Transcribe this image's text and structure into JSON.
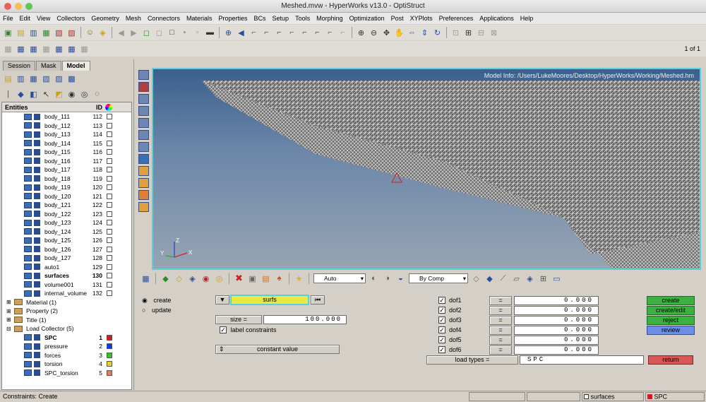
{
  "window": {
    "title": "Meshed.mvw - HyperWorks v13.0 - OptiStruct",
    "page_indicator": "1 of 1"
  },
  "menu": [
    "File",
    "Edit",
    "View",
    "Collectors",
    "Geometry",
    "Mesh",
    "Connectors",
    "Materials",
    "Properties",
    "BCs",
    "Setup",
    "Tools",
    "Morphing",
    "Optimization",
    "Post",
    "XYPlots",
    "Preferences",
    "Applications",
    "Help"
  ],
  "tabs": [
    "Session",
    "Mask",
    "Model"
  ],
  "tree": {
    "col_entities": "Entities",
    "col_id": "ID",
    "bodies": [
      {
        "name": "body_111",
        "id": "112"
      },
      {
        "name": "body_112",
        "id": "113"
      },
      {
        "name": "body_113",
        "id": "114"
      },
      {
        "name": "body_114",
        "id": "115"
      },
      {
        "name": "body_115",
        "id": "116"
      },
      {
        "name": "body_116",
        "id": "117"
      },
      {
        "name": "body_117",
        "id": "118"
      },
      {
        "name": "body_118",
        "id": "119"
      },
      {
        "name": "body_119",
        "id": "120"
      },
      {
        "name": "body_120",
        "id": "121"
      },
      {
        "name": "body_121",
        "id": "122"
      },
      {
        "name": "body_122",
        "id": "123"
      },
      {
        "name": "body_123",
        "id": "124"
      },
      {
        "name": "body_124",
        "id": "125"
      },
      {
        "name": "body_125",
        "id": "126"
      },
      {
        "name": "body_126",
        "id": "127"
      },
      {
        "name": "body_127",
        "id": "128"
      },
      {
        "name": "auto1",
        "id": "129"
      },
      {
        "name": "surfaces",
        "id": "130"
      },
      {
        "name": "volume001",
        "id": "131"
      },
      {
        "name": "internal_volume",
        "id": "132"
      }
    ],
    "groups": [
      "Material (1)",
      "Property (2)",
      "Title (1)",
      "Load Collector (5)"
    ],
    "loads": [
      {
        "name": "SPC",
        "id": "1",
        "color": "#e0141e"
      },
      {
        "name": "pressure",
        "id": "2",
        "color": "#1436e6"
      },
      {
        "name": "forces",
        "id": "3",
        "color": "#2ec82e"
      },
      {
        "name": "torsion",
        "id": "4",
        "color": "#e8d21e"
      },
      {
        "name": "SPC_torsion",
        "id": "5",
        "color": "#e8785a"
      }
    ]
  },
  "viewport": {
    "model_info": "Model Info: /Users/LukeMoores/Desktop/HyperWorks/Working/Meshed.hm"
  },
  "bottom_toolbar": {
    "vis_mode": "Auto",
    "color_mode": "By Comp"
  },
  "panel": {
    "radio_create": "create",
    "radio_update": "update",
    "selector": "surfs",
    "size_label": "size =",
    "size_value": "100.000",
    "label_constraints": "label constraints",
    "constant_value": "constant value",
    "dofs": [
      {
        "label": "dof1",
        "eq": "=",
        "value": "0.000"
      },
      {
        "label": "dof2",
        "eq": "=",
        "value": "0.000"
      },
      {
        "label": "dof3",
        "eq": "=",
        "value": "0.000"
      },
      {
        "label": "dof4",
        "eq": "=",
        "value": "0.000"
      },
      {
        "label": "dof5",
        "eq": "=",
        "value": "0.000"
      },
      {
        "label": "dof6",
        "eq": "=",
        "value": "0.000"
      }
    ],
    "load_types_label": "load types =",
    "load_types_value": "SPC",
    "actions": [
      "create",
      "create/edit",
      "reject",
      "review"
    ],
    "return_label": "return"
  },
  "status": {
    "left": "Constraints:  Create",
    "comp": "surfaces",
    "collector": "SPC"
  }
}
